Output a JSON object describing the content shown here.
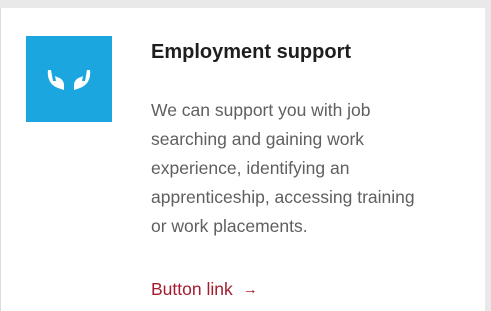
{
  "card": {
    "icon": "caring-hands-icon",
    "accent_color": "#1ba6e0",
    "title": "Employment support",
    "description_lines": [
      "We can support you with job",
      "searching and gaining work",
      "experience, identifying an",
      "apprenticeship, accessing training",
      "or work placements."
    ],
    "link": {
      "label": "Button link",
      "arrow_icon": "arrow-right-icon",
      "arrow_glyph": "→",
      "color": "#a31d2e"
    }
  }
}
